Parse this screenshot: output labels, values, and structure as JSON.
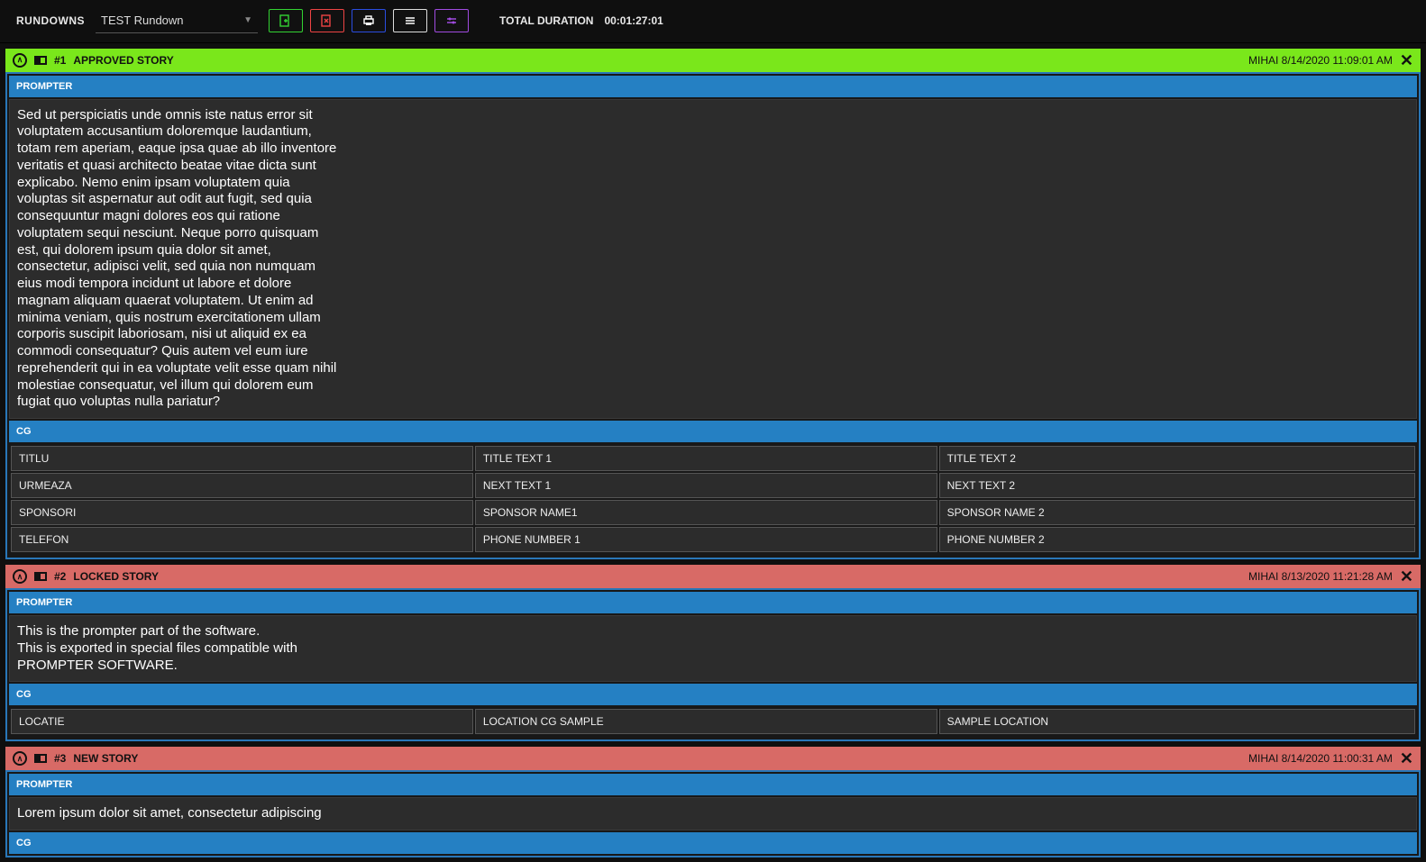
{
  "toolbar": {
    "rundowns_label": "RUNDOWNS",
    "selected_rundown": "TEST Rundown",
    "total_duration_label": "TOTAL DURATION",
    "total_duration_value": "00:01:27:01"
  },
  "stories": [
    {
      "number": "#1",
      "title": "APPROVED STORY",
      "header_class": "hdr-green",
      "meta": "MIHAI 8/14/2020 11:09:01 AM",
      "prompter_label": "PROMPTER",
      "prompter_text": "Sed ut perspiciatis unde omnis iste natus error sit voluptatem accusantium doloremque laudantium, totam rem aperiam, eaque ipsa quae ab illo inventore veritatis et quasi architecto beatae vitae dicta sunt explicabo. Nemo enim ipsam voluptatem quia voluptas sit aspernatur aut odit aut fugit, sed quia consequuntur magni dolores eos qui ratione voluptatem sequi nesciunt. Neque porro quisquam est, qui dolorem ipsum quia dolor sit amet, consectetur, adipisci velit, sed quia non numquam eius modi tempora incidunt ut labore et dolore magnam aliquam quaerat voluptatem. Ut enim ad minima veniam, quis nostrum exercitationem ullam corporis suscipit laboriosam, nisi ut aliquid ex ea commodi consequatur? Quis autem vel eum iure reprehenderit qui in ea voluptate velit esse quam nihil molestiae consequatur, vel illum qui dolorem eum fugiat quo voluptas nulla pariatur?",
      "cg_label": "CG",
      "cg_rows": [
        [
          "TITLU",
          "TITLE TEXT 1",
          "TITLE TEXT 2"
        ],
        [
          "URMEAZA",
          "NEXT TEXT 1",
          "NEXT TEXT 2"
        ],
        [
          "SPONSORI",
          "SPONSOR NAME1",
          "SPONSOR NAME 2"
        ],
        [
          "TELEFON",
          "PHONE NUMBER 1",
          "PHONE NUMBER 2"
        ]
      ]
    },
    {
      "number": "#2",
      "title": "LOCKED STORY",
      "header_class": "hdr-red",
      "meta": "MIHAI 8/13/2020 11:21:28 AM",
      "prompter_label": "PROMPTER",
      "prompter_text": "This is the prompter part of the software.\nThis is exported in special files compatible with PROMPTER SOFTWARE.",
      "cg_label": "CG",
      "cg_rows": [
        [
          "LOCATIE",
          "LOCATION CG SAMPLE",
          "SAMPLE LOCATION"
        ]
      ]
    },
    {
      "number": "#3",
      "title": "NEW STORY",
      "header_class": "hdr-red",
      "meta": "MIHAI 8/14/2020 11:00:31 AM",
      "prompter_label": "PROMPTER",
      "prompter_text": "Lorem ipsum dolor sit amet, consectetur adipiscing",
      "cg_label": "CG",
      "cg_rows": []
    }
  ]
}
